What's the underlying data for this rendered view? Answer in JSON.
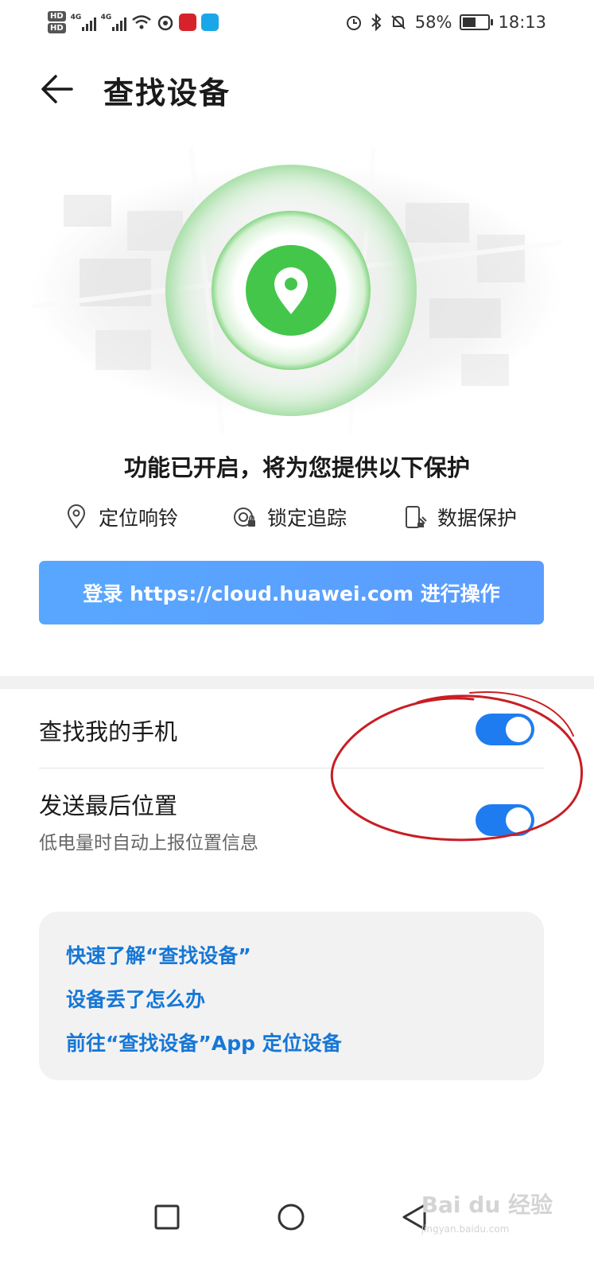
{
  "status_bar": {
    "hd1": "HD",
    "hd2": "HD",
    "net1": "4G",
    "net2": "4G",
    "battery": "58%",
    "battery_level": 0.58,
    "time": "18:13"
  },
  "header": {
    "title": "查找设备"
  },
  "hero": {
    "status_text": "功能已开启，将为您提供以下保护"
  },
  "features": [
    {
      "label": "定位响铃",
      "icon": "location-pin-icon"
    },
    {
      "label": "锁定追踪",
      "icon": "lock-track-icon"
    },
    {
      "label": "数据保护",
      "icon": "data-protect-icon"
    }
  ],
  "login_button": {
    "label": "登录 https://cloud.huawei.com 进行操作"
  },
  "settings": [
    {
      "title": "查找我的手机",
      "enabled": true
    },
    {
      "title": "发送最后位置",
      "subtitle": "低电量时自动上报位置信息",
      "enabled": true
    }
  ],
  "help_links": [
    "快速了解“查找设备”",
    "设备丢了怎么办",
    "前往“查找设备”App 定位设备"
  ],
  "colors": {
    "accent_blue": "#1f7cf0",
    "link_blue": "#1677d6",
    "pin_green": "#44c64a",
    "login_button": "#5aa2ff",
    "annotation_red": "#c81e24"
  },
  "watermark": {
    "text": "Bai du 经验",
    "sub": "jingyan.baidu.com"
  }
}
